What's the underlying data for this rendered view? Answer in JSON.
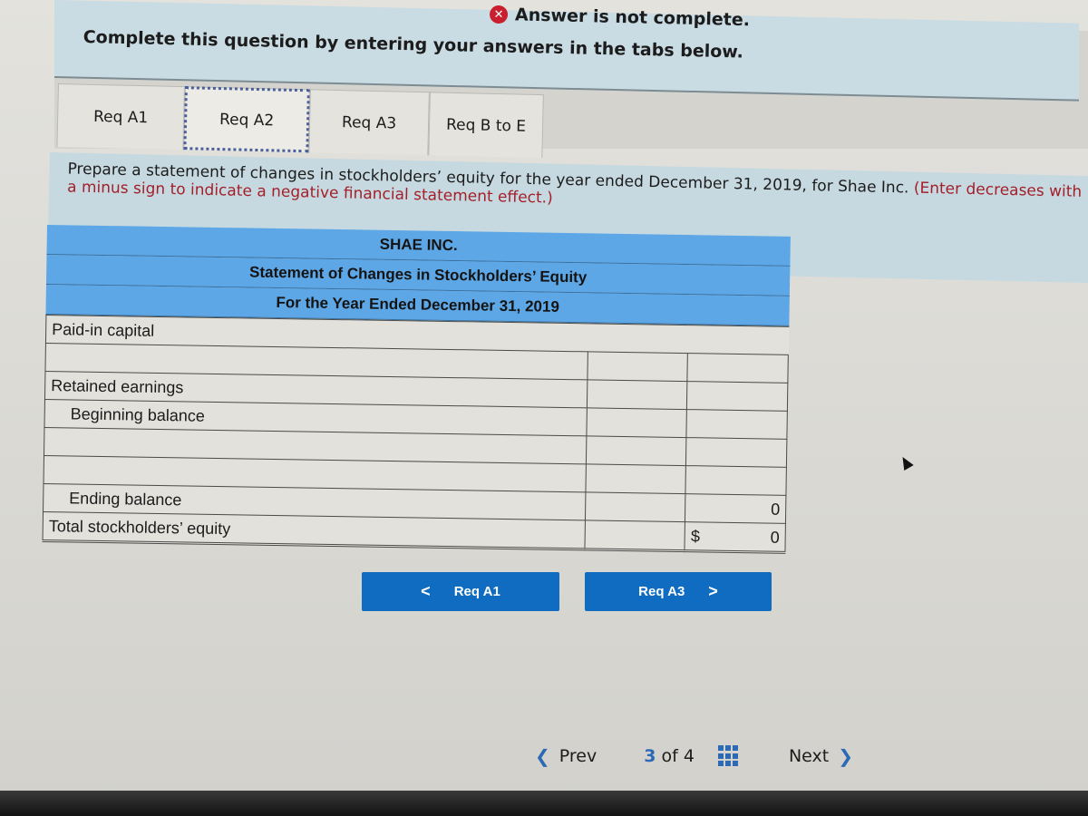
{
  "status": {
    "icon": "error-x-icon",
    "text": "Answer is not complete."
  },
  "instruction": "Complete this question by entering your answers in the tabs below.",
  "tabs": [
    {
      "label": "Req A1",
      "active": false
    },
    {
      "label": "Req A2",
      "active": true
    },
    {
      "label": "Req A3",
      "active": false
    },
    {
      "label": "Req B to E",
      "active": false
    }
  ],
  "prompt": {
    "main": "Prepare a statement of changes in stockholders’ equity for the year ended December 31, 2019, for Shae Inc.",
    "note": "(Enter decreases with a minus sign to indicate a negative financial statement effect.)"
  },
  "statement": {
    "company": "SHAE INC.",
    "title": "Statement of Changes in Stockholders’ Equity",
    "period": "For the Year Ended December 31, 2019",
    "rows": [
      {
        "label": "Paid-in capital",
        "col1": "",
        "col2": ""
      },
      {
        "label": "",
        "col1": "",
        "col2": ""
      },
      {
        "label": "Retained earnings",
        "col1": "",
        "col2": ""
      },
      {
        "label": "Beginning balance",
        "col1": "",
        "col2": ""
      },
      {
        "label": "",
        "col1": "",
        "col2": ""
      },
      {
        "label": "",
        "col1": "",
        "col2": ""
      },
      {
        "label": "Ending balance",
        "col1": "",
        "col2": "0"
      },
      {
        "label": "Total stockholders’ equity",
        "col1": "",
        "currency": "$",
        "col2": "0"
      }
    ]
  },
  "nav": {
    "prev_req": "Req A1",
    "next_req": "Req A3"
  },
  "footer": {
    "prev": "Prev",
    "current_page": "3",
    "of_label": "of",
    "total_pages": "4",
    "next": "Next"
  },
  "colors": {
    "header_blue": "#5ea7e6",
    "button_blue": "#0f6cc0",
    "error_red": "#c8202e",
    "note_red": "#a3202a",
    "link_blue": "#2d6ab6"
  }
}
